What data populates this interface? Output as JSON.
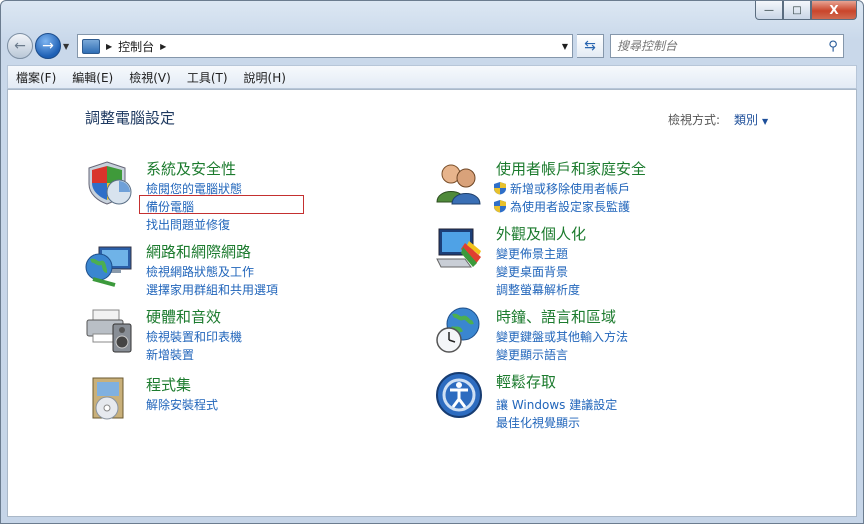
{
  "window": {
    "minimize": "—",
    "maximize": "□",
    "close": "X"
  },
  "navbar": {
    "address_location": "控制台",
    "search_placeholder": "搜尋控制台"
  },
  "menu": [
    "檔案(F)",
    "編輯(E)",
    "檢視(V)",
    "工具(T)",
    "說明(H)"
  ],
  "main": {
    "title": "調整電腦設定",
    "viewby_label": "檢視方式:",
    "viewby_value": "類別"
  },
  "categories": [
    {
      "title": "系統及安全性",
      "links": [
        "檢閱您的電腦狀態",
        "備份電腦",
        "找出問題並修復"
      ],
      "icon": "shield-icon"
    },
    {
      "title": "網路和網際網路",
      "links": [
        "檢視網路狀態及工作",
        "選擇家用群組和共用選項"
      ],
      "icon": "network-icon"
    },
    {
      "title": "硬體和音效",
      "links": [
        "檢視裝置和印表機",
        "新增裝置"
      ],
      "icon": "printer-icon"
    },
    {
      "title": "程式集",
      "links": [
        "解除安裝程式"
      ],
      "icon": "programs-icon"
    },
    {
      "title": "使用者帳戶和家庭安全",
      "links": [
        "新增或移除使用者帳戶",
        "為使用者設定家長監護"
      ],
      "icon": "users-icon"
    },
    {
      "title": "外觀及個人化",
      "links": [
        "變更佈景主題",
        "變更桌面背景",
        "調整螢幕解析度"
      ],
      "icon": "display-icon"
    },
    {
      "title": "時鐘、語言和區域",
      "links": [
        "變更鍵盤或其他輸入方法",
        "變更顯示語言"
      ],
      "icon": "clock-globe-icon"
    },
    {
      "title": "輕鬆存取",
      "links": [
        "讓 Windows 建議設定",
        "最佳化視覺顯示"
      ],
      "icon": "ease-of-access-icon"
    }
  ],
  "colors": {
    "category_title": "#1c7b2e",
    "link": "#2266bb",
    "highlight_box": "#c43030"
  }
}
